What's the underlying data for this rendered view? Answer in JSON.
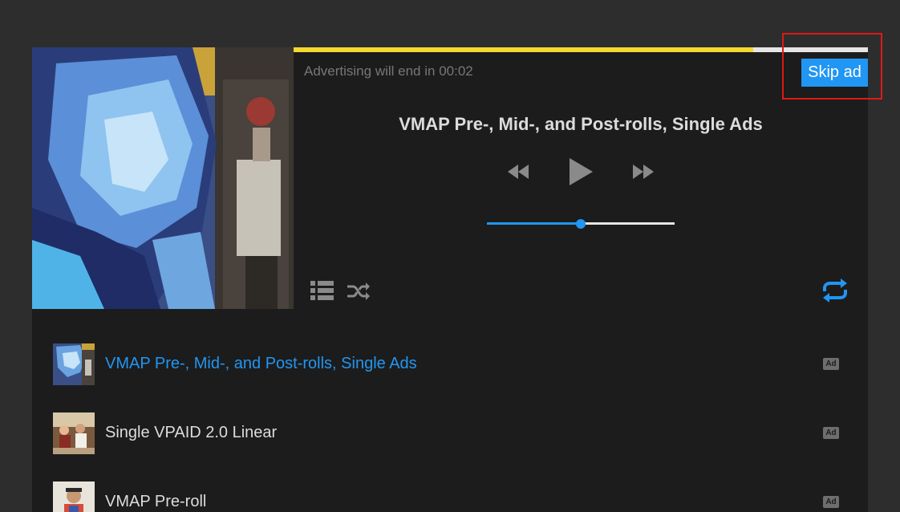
{
  "ad": {
    "countdown_text": "Advertising will end in 00:02",
    "skip_label": "Skip ad",
    "progress": 0.8
  },
  "player": {
    "title": "VMAP Pre-, Mid-, and Post-rolls, Single Ads",
    "volume": 0.5,
    "icons": {
      "rewind": "rewind-icon",
      "play": "play-icon",
      "forward": "fast-forward-icon",
      "playlist": "playlist-icon",
      "shuffle": "shuffle-icon",
      "repeat": "repeat-icon"
    }
  },
  "playlist": {
    "items": [
      {
        "label": "VMAP Pre-, Mid-, and Post-rolls, Single Ads",
        "badge": "Ad",
        "active": true
      },
      {
        "label": "Single VPAID 2.0 Linear",
        "badge": "Ad",
        "active": false
      },
      {
        "label": "VMAP Pre-roll",
        "badge": "Ad",
        "active": false
      }
    ]
  },
  "colors": {
    "accent": "#2196f3",
    "ad_progress": "#f5d92e",
    "background": "#2d2d2d",
    "panel": "#1c1c1c",
    "highlight": "#e01818"
  }
}
